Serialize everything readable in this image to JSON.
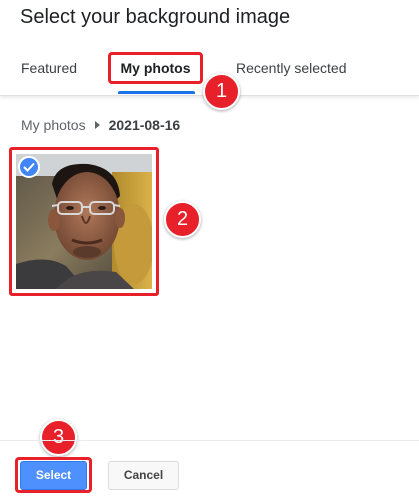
{
  "dialog": {
    "title": "Select your background image"
  },
  "tabs": [
    {
      "label": "Featured"
    },
    {
      "label": "My photos"
    },
    {
      "label": "Recently selected"
    }
  ],
  "breadcrumb": {
    "root": "My photos",
    "current": "2021-08-16"
  },
  "photo": {
    "selected": true,
    "check_icon": "checkmark-icon"
  },
  "callouts": [
    "1",
    "2",
    "3"
  ],
  "footer": {
    "select_label": "Select",
    "cancel_label": "Cancel"
  },
  "colors": {
    "accent": "#1a73e8",
    "highlight": "#e8202a",
    "select_button": "#4d90fe",
    "badge": "#4285f4"
  }
}
